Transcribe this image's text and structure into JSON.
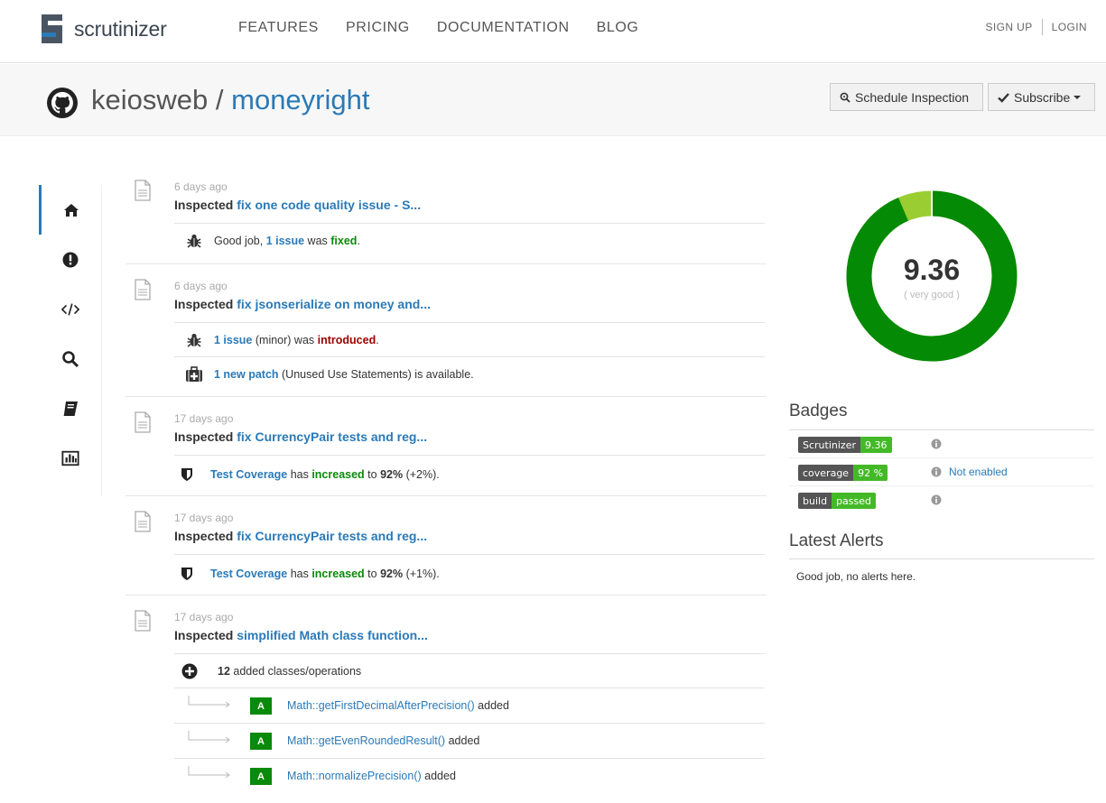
{
  "brand": {
    "name": "scrutinizer"
  },
  "nav": [
    "FEATURES",
    "PRICING",
    "DOCUMENTATION",
    "BLOG"
  ],
  "auth": {
    "signup": "SIGN UP",
    "login": "LOGIN"
  },
  "repo": {
    "owner": "keiosweb",
    "separator": "/",
    "name": "moneyright"
  },
  "buttons": {
    "schedule": "Schedule Inspection",
    "subscribe": "Subscribe"
  },
  "sidebar": [
    "home-icon",
    "alert-icon",
    "code-icon",
    "search-icon",
    "book-icon",
    "chart-icon"
  ],
  "feed": [
    {
      "date": "6 days ago",
      "prefix": "Inspected",
      "commit": "fix one code quality issue - S...",
      "row1": {
        "a": "Good job, ",
        "link": "1 issue",
        "b": " was ",
        "status": "fixed",
        "c": "."
      }
    },
    {
      "date": "6 days ago",
      "prefix": "Inspected",
      "commit": "fix jsonserialize on money and...",
      "row1": {
        "link": "1 issue",
        "b": " (minor) was ",
        "status": "introduced",
        "c": "."
      },
      "row2": {
        "link": "1 new patch",
        "b": " (Unused Use Statements) is available."
      }
    },
    {
      "date": "17 days ago",
      "prefix": "Inspected",
      "commit": "fix CurrencyPair tests and reg...",
      "row1": {
        "link": "Test Coverage",
        "b": " has ",
        "status": "increased",
        "c": " to ",
        "pct": "92%",
        "d": " (+2%)."
      }
    },
    {
      "date": "17 days ago",
      "prefix": "Inspected",
      "commit": "fix CurrencyPair tests and reg...",
      "row1": {
        "link": "Test Coverage",
        "b": " has ",
        "status": "increased",
        "c": " to ",
        "pct": "92%",
        "d": " (+1%)."
      }
    },
    {
      "date": "17 days ago",
      "prefix": "Inspected",
      "commit": "simplified Math class function...",
      "row1": {
        "count": "12",
        "b": " added classes/operations"
      },
      "subs": [
        {
          "grade": "A",
          "method": "Math::getFirstDecimalAfterPrecision()",
          "suffix": " added"
        },
        {
          "grade": "A",
          "method": "Math::getEvenRoundedResult()",
          "suffix": " added"
        },
        {
          "grade": "A",
          "method": "Math::normalizePrecision()",
          "suffix": " added"
        }
      ]
    }
  ],
  "score": {
    "value": "9.36",
    "label": "( very good )",
    "fraction": 0.936,
    "colors": {
      "good": "#058a05",
      "light": "#9acd32"
    }
  },
  "badges": {
    "heading": "Badges",
    "items": [
      {
        "label": "Scrutinizer",
        "value": "9.36",
        "note": ""
      },
      {
        "label": "coverage",
        "value": "92 %",
        "note": "Not enabled"
      },
      {
        "label": "build",
        "value": "passed",
        "note": ""
      }
    ]
  },
  "alerts": {
    "heading": "Latest Alerts",
    "text": "Good job, no alerts here."
  }
}
